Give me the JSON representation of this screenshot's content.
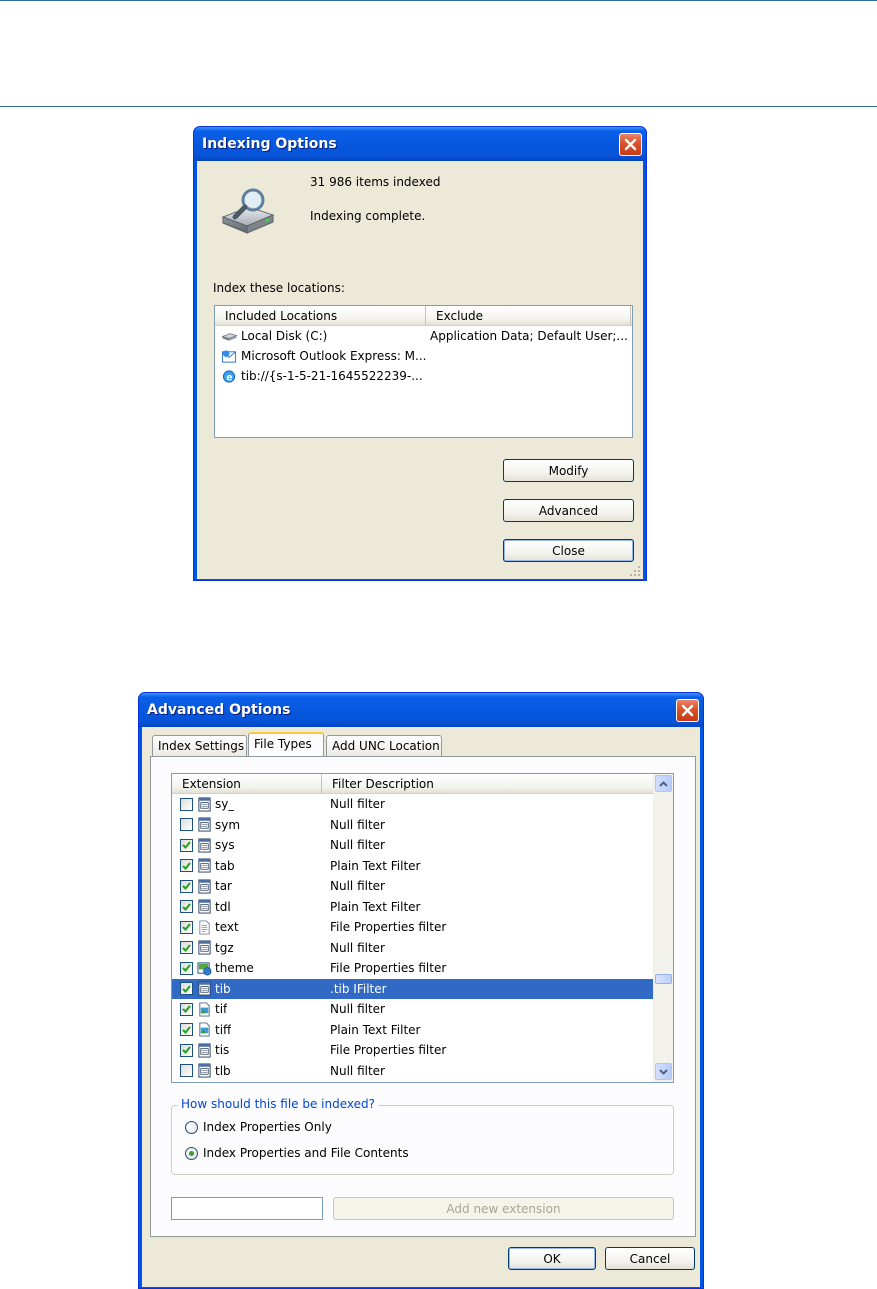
{
  "indexing_options": {
    "title": "Indexing Options",
    "items_indexed": "31 986 items indexed",
    "status": "Indexing complete.",
    "index_locations_label": "Index these locations:",
    "columns": [
      "Included Locations",
      "Exclude"
    ],
    "locations": [
      {
        "name": "Local Disk (C:)",
        "exclude": "Application Data; Default User;...",
        "icon": "drive-icon"
      },
      {
        "name": "Microsoft Outlook Express: M...",
        "exclude": "",
        "icon": "outlook-express-icon"
      },
      {
        "name": "tib://{s-1-5-21-1645522239-...",
        "exclude": "",
        "icon": "ie-icon"
      }
    ],
    "buttons": {
      "modify": "Modify",
      "advanced": "Advanced",
      "close": "Close"
    }
  },
  "advanced_options": {
    "title": "Advanced Options",
    "tabs": [
      "Index Settings",
      "File Types",
      "Add UNC Location"
    ],
    "active_tab": "File Types",
    "columns": [
      "Extension",
      "Filter Description"
    ],
    "file_types": [
      {
        "ext": "sy_",
        "filter": "Null filter",
        "checked": false,
        "icon": "file-icon"
      },
      {
        "ext": "sym",
        "filter": "Null filter",
        "checked": false,
        "icon": "file-icon"
      },
      {
        "ext": "sys",
        "filter": "Null filter",
        "checked": true,
        "icon": "file-icon"
      },
      {
        "ext": "tab",
        "filter": "Plain Text Filter",
        "checked": true,
        "icon": "file-icon"
      },
      {
        "ext": "tar",
        "filter": "Null filter",
        "checked": true,
        "icon": "file-icon"
      },
      {
        "ext": "tdl",
        "filter": "Plain Text Filter",
        "checked": true,
        "icon": "file-icon"
      },
      {
        "ext": "text",
        "filter": "File Properties filter",
        "checked": true,
        "icon": "text-file-icon"
      },
      {
        "ext": "tgz",
        "filter": "Null filter",
        "checked": true,
        "icon": "file-icon"
      },
      {
        "ext": "theme",
        "filter": "File Properties filter",
        "checked": true,
        "icon": "theme-icon"
      },
      {
        "ext": "tib",
        "filter": ".tib IFilter",
        "checked": true,
        "icon": "file-icon",
        "selected": true
      },
      {
        "ext": "tif",
        "filter": "Null filter",
        "checked": true,
        "icon": "image-file-icon"
      },
      {
        "ext": "tiff",
        "filter": "Plain Text Filter",
        "checked": true,
        "icon": "image-file-icon"
      },
      {
        "ext": "tis",
        "filter": "File Properties filter",
        "checked": true,
        "icon": "file-icon"
      },
      {
        "ext": "tlb",
        "filter": "Null filter",
        "checked": false,
        "icon": "file-icon"
      }
    ],
    "index_group_label": "How should this file be indexed?",
    "radio_options": [
      "Index Properties Only",
      "Index Properties and File Contents"
    ],
    "radio_selected": 1,
    "new_extension_value": "",
    "add_extension_label": "Add new extension",
    "ok_label": "OK",
    "cancel_label": "Cancel"
  },
  "colors": {
    "title_blue": "#0758e0",
    "dialog_bg": "#ece9d8",
    "selection": "#316ac5",
    "group_label": "#0046d5"
  }
}
